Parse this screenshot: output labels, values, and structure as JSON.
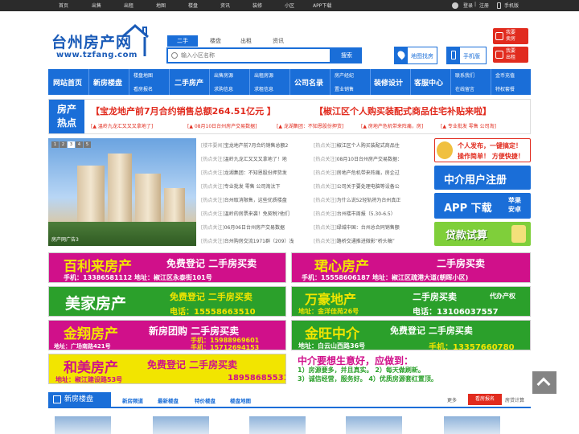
{
  "topnav": {
    "items": [
      "首页",
      "出售",
      "出租",
      "地图",
      "楼盘",
      "资讯",
      "装修",
      "小区",
      "APP下载"
    ],
    "login": "登录",
    "sep": "|",
    "register": "注册",
    "mobile": "手机版"
  },
  "logo": {
    "title": "台州房产网",
    "url": "www.tzfang.com"
  },
  "search": {
    "tabs": [
      "二手",
      "楼盘",
      "出租",
      "资讯"
    ],
    "active_tab": "二手",
    "placeholder": "输入小区名称",
    "button": "搜索"
  },
  "tools": {
    "map": "地图找房",
    "mobile": "手机版"
  },
  "red_buttons": [
    {
      "l1": "我要",
      "l2": "卖房"
    },
    {
      "l1": "我要",
      "l2": "出租"
    }
  ],
  "nav": {
    "home": "网站首页",
    "newhouse": "新房楼盘",
    "nh_sub": [
      "楼盘地图",
      "看房报名"
    ],
    "second": "二手房产",
    "second_sub": [
      "出售房源",
      "求购信息"
    ],
    "rent_sub": [
      "出租房源",
      "求租信息"
    ],
    "agency": "公司名录",
    "agency_sub": [
      "房产经纪",
      "置业销售"
    ],
    "deco": "装修设计",
    "service": "客服中心",
    "service_sub": [
      "联系我们",
      "在线留言"
    ],
    "extra_sub": [
      "金币充值",
      "特权套餐"
    ]
  },
  "hot": {
    "badge": [
      "房产",
      "热点"
    ],
    "headline1": "【宝龙地产前7月合约销售总额264.51亿元 】",
    "headline2": "【椒江区个人购买装配式商品住宅补贴来啦】",
    "subs": [
      "[▲ 温岭九龙汇又又又拿地了]",
      "[▲ 08月10日台州房产交易数据]",
      "[▲ 龙湖集团：不知恩股份押货]",
      "[▲ 房地产危机带来阵痛，房]",
      "[▲ 专业批发 零售 公司淘]"
    ]
  },
  "slider": {
    "pages": [
      "1",
      "2",
      "3",
      "4",
      "5"
    ],
    "active": "3",
    "caption": "房产网广告3"
  },
  "news_left": [
    [
      "[楼市要闻]",
      "宝龙地产前7月合约销售总额2"
    ],
    [
      "[热点关注]",
      "温岭九龙汇又又又拿地了！地"
    ],
    [
      "[热点关注]",
      "龙湖集团：不知恩股份押货发"
    ],
    [
      "[热点关注]",
      "专业批发 零售 公司淘汰下"
    ],
    [
      "[热点关注]",
      "台州取消限售，这些优质楼盘"
    ],
    [
      "[热点关注]",
      "温岭的房票来袭！免契税?他们"
    ],
    [
      "[热点关注]",
      "06月06日台州房产交易数据"
    ],
    [
      "[热点关注]",
      "台州购房交流1971群（209）浅"
    ]
  ],
  "news_right": [
    [
      "[热点关注]",
      "椒江区个人购买装配式商品住"
    ],
    [
      "[热点关注]",
      "08月10日台州房产交易数据："
    ],
    [
      "[热点关注]",
      "房地产危机带来阵痛，房企过"
    ],
    [
      "[热点关注]",
      "公司关于要处理电脑等设备公"
    ],
    [
      "[热点关注]",
      "为什么说52轻轨将为台州真正"
    ],
    [
      "[热点关注]",
      "台州楼市周报（5.30-6.5）"
    ],
    [
      "[热点关注]",
      "绿城中国：台州总合同销售额"
    ],
    [
      "[热点关注]",
      "路桥交通推进微影“桥头稿”"
    ]
  ],
  "side": {
    "post": {
      "l1": "个人发布，一键搞定！",
      "l2": "操作简单！ 方便快捷！"
    },
    "agent": "中介用户注册",
    "app": {
      "title": "APP 下载",
      "l1": "苹果",
      "l2": "安卓"
    },
    "loan": "贷款试算"
  },
  "ads": [
    {
      "name": "百利来房产",
      "slogan": "免费登记 二手房买卖",
      "line": "手机：13386581112 地址：椒江区永泰街101号"
    },
    {
      "name": "珺心房产",
      "slogan": "二手房买卖",
      "line": "手机：15558606187 地址：椒江区疏港大道(朝晖小区)"
    },
    {
      "name": "美家房产",
      "slogan": "免费登记 二手房买卖",
      "line": "电话：15558663510"
    },
    {
      "name": "万豪地产",
      "slogan": "二手房买卖",
      "sub": "代办产权",
      "line": "地址：金洋佳苑26号",
      "phone": "电话：13106037557"
    },
    {
      "name": "金翔房产",
      "slogan": "新房团购 二手房买卖",
      "line": "地址：广场南路421号",
      "p1": "手机：15988969601",
      "p2": "手机：15712694153"
    },
    {
      "name": "金旺中介",
      "slogan": "免费登记 二手房买卖",
      "line": "地址：白云山西路36号",
      "phone": "手机：13357660780"
    },
    {
      "name": "和美房产",
      "slogan": "免费登记 二手房买卖",
      "line": "地址：椒江建设路53号",
      "phone": "18958685531"
    },
    {
      "title": "中介要想生意好，应做到：",
      "l1": "1）房源要多，并且真实。 2）每天做刷新。",
      "l2": "3）诚信经营，服务好。 4）优质房源套红置顶。"
    }
  ],
  "section": {
    "title": "新房楼盘",
    "links": [
      "新房频道",
      "最新楼盘",
      "特价楼盘",
      "楼盘地图"
    ],
    "more": "更多",
    "btn": "看房报名",
    "calc": "房贷计算"
  },
  "colors": {
    "blue": "#1a6ed8",
    "red": "#e12b1e",
    "magenta": "#d0108a",
    "green": "#2ba02b",
    "yellow": "#f2e500"
  }
}
